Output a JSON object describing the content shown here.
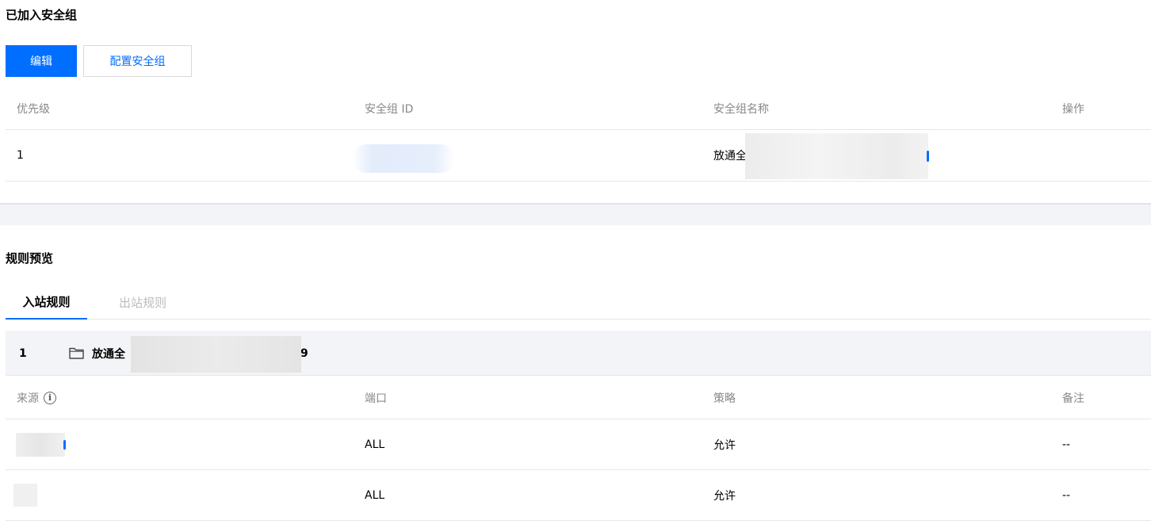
{
  "joined_section": {
    "title": "已加入安全组",
    "edit_label": "编辑",
    "config_label": "配置安全组",
    "columns": [
      "优先级",
      "安全组 ID",
      "安全组名称",
      "操作"
    ],
    "row": {
      "priority": "1",
      "name_prefix": "放通全"
    }
  },
  "preview_section": {
    "title": "规则预览",
    "tabs": [
      {
        "label": "入站规则",
        "active": true
      },
      {
        "label": "出站规则",
        "active": false
      }
    ],
    "group": {
      "index": "1",
      "name_prefix": "放通全",
      "name_suffix": "9"
    },
    "columns": [
      "来源",
      "端口",
      "策略",
      "备注"
    ],
    "rows": [
      {
        "port": "ALL",
        "policy": "允许",
        "note": "--"
      },
      {
        "port": "ALL",
        "policy": "允许",
        "note": "--"
      }
    ]
  },
  "colors": {
    "primary": "#006eff",
    "header_text": "#888888",
    "band": "#f3f4f7"
  }
}
